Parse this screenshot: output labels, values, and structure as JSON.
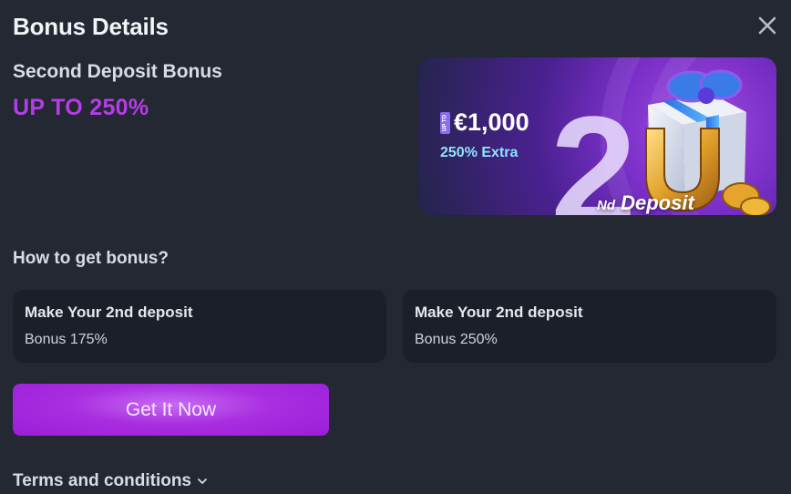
{
  "modal": {
    "title": "Bonus Details",
    "close_icon": "close-icon"
  },
  "bonus": {
    "name": "Second Deposit Bonus",
    "amount": "UP TO 250%"
  },
  "banner": {
    "tag": "UP TO",
    "max_amount": "€1,000",
    "extra": "250% Extra",
    "big_number": "2",
    "nd": "Nd",
    "deposit": "Deposit",
    "illustration": [
      "gift-icon",
      "horseshoe-icon",
      "coins-icon"
    ]
  },
  "how_to": {
    "title": "How to get bonus?",
    "steps": [
      {
        "title": "Make Your 2nd deposit",
        "subtitle": "Bonus 175%"
      },
      {
        "title": "Make Your 2nd deposit",
        "subtitle": "Bonus 250%"
      }
    ]
  },
  "cta": {
    "label": "Get It Now"
  },
  "terms": {
    "label": "Terms and conditions",
    "icon": "chevron-down-icon"
  },
  "colors": {
    "background": "#232833",
    "card": "#1b1f28",
    "accent": "#b63ce8",
    "button": "#a92ee0"
  }
}
